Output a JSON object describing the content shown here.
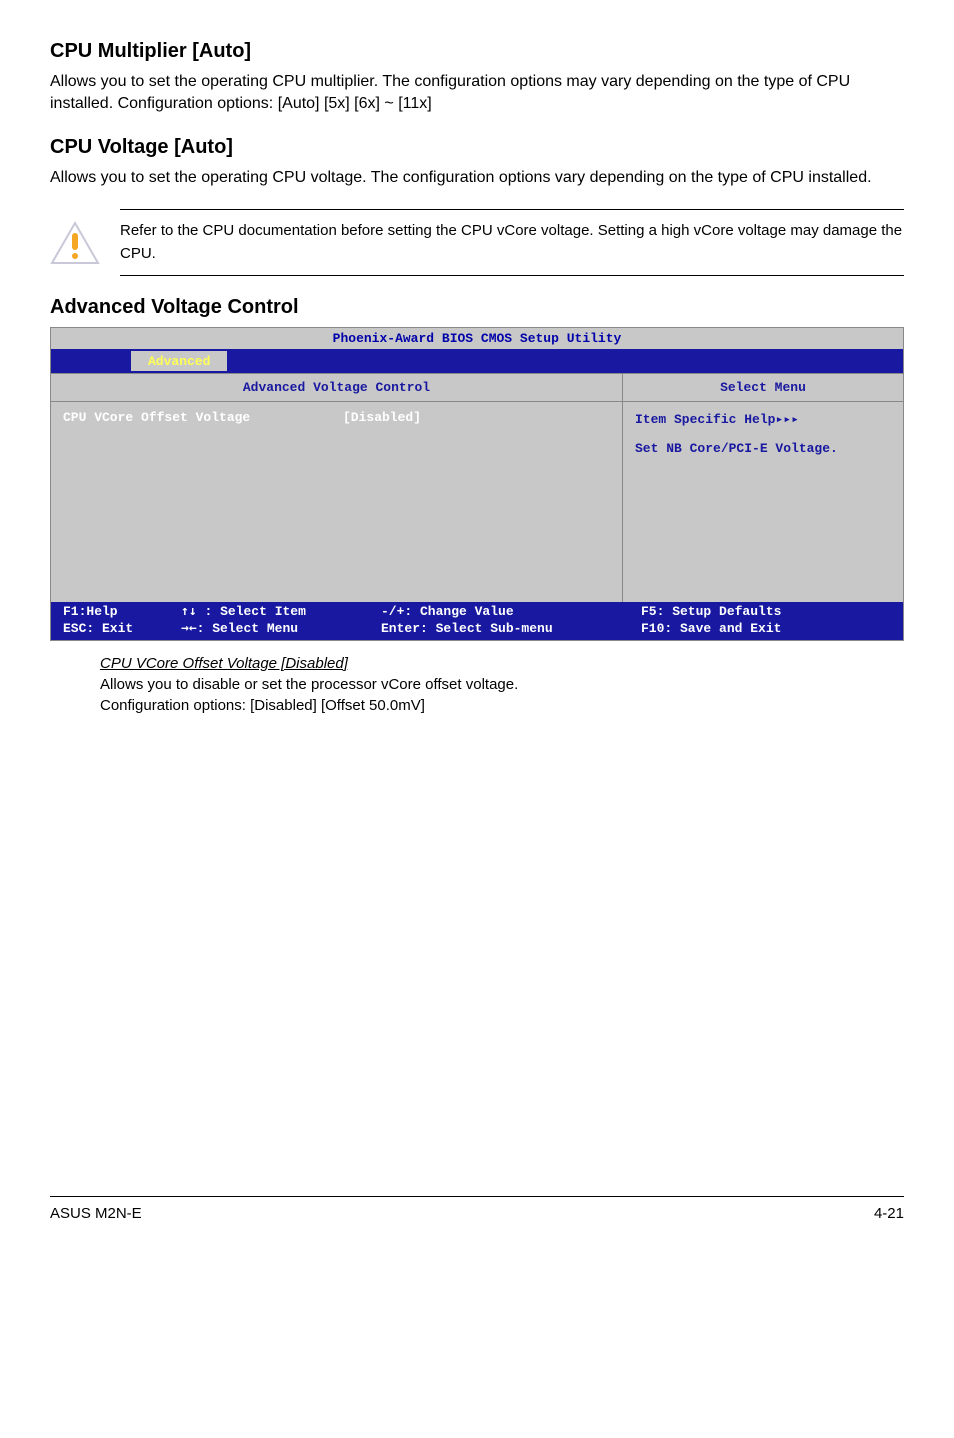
{
  "sections": {
    "cpu_multiplier": {
      "heading": "CPU Multiplier [Auto]",
      "body": "Allows you to set the operating CPU multiplier. The configuration options may vary depending on the type of CPU installed. Configuration options: [Auto] [5x] [6x] ~ [11x]"
    },
    "cpu_voltage": {
      "heading": "CPU Voltage [Auto]",
      "body": "Allows you to set the operating CPU voltage. The configuration options vary depending on the type of CPU installed."
    },
    "caution": {
      "text": "Refer to the CPU documentation before setting the CPU vCore voltage. Setting a high vCore voltage may damage the CPU."
    },
    "advanced_voltage": {
      "heading": "Advanced Voltage Control"
    }
  },
  "bios": {
    "title": "Phoenix-Award BIOS CMOS Setup Utility",
    "menubar_tab": "Advanced",
    "section_header": "Advanced Voltage Control",
    "row_label": "CPU VCore Offset Voltage",
    "row_value": "[Disabled]",
    "side_header": "Select Menu",
    "side_help_label": "Item Specific Help",
    "side_help_text": "Set NB Core/PCI-E Voltage.",
    "footer": {
      "f1": "F1:Help",
      "esc": "ESC: Exit",
      "select_item": ": Select Item",
      "select_menu": ": Select Menu",
      "change_value": "-/+: Change Value",
      "select_submenu": "Enter: Select Sub-menu",
      "f5": "F5: Setup Defaults",
      "f10": "F10: Save and Exit"
    }
  },
  "sub_item": {
    "heading": "CPU VCore Offset Voltage [Disabled]",
    "line1": "Allows you to disable or set the processor vCore offset voltage.",
    "line2": "Configuration options: [Disabled] [Offset 50.0mV]"
  },
  "footer": {
    "product": "ASUS M2N-E",
    "page": "4-21"
  },
  "icon_colors": {
    "caution_outer": "#d8d8e8",
    "caution_inner": "#fff",
    "caution_bang": "#f5a623"
  }
}
